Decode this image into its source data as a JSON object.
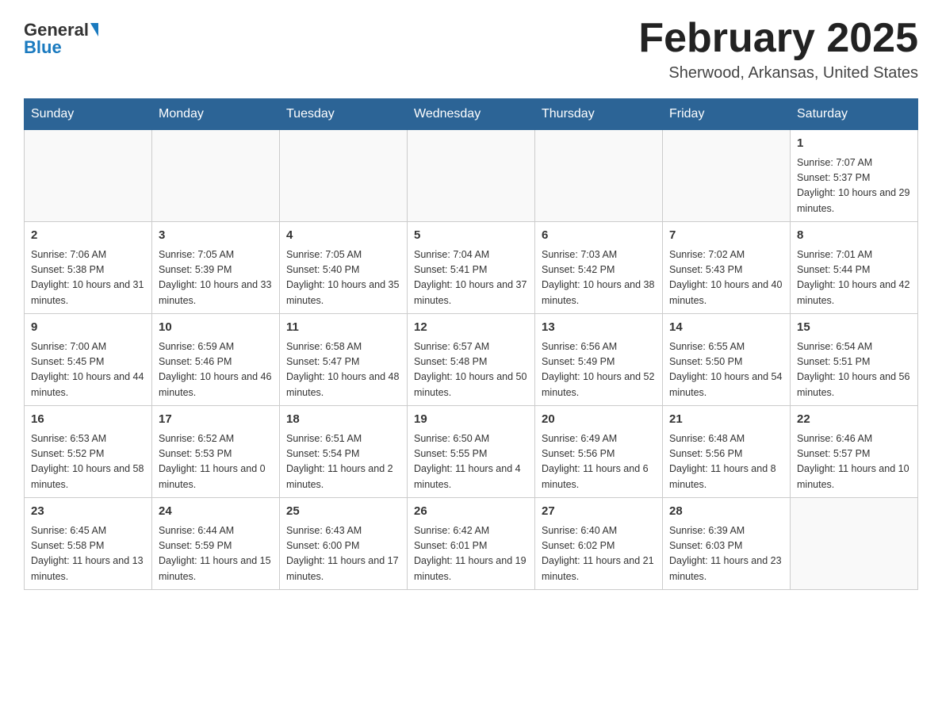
{
  "header": {
    "logo_general": "General",
    "logo_blue": "Blue",
    "title": "February 2025",
    "subtitle": "Sherwood, Arkansas, United States"
  },
  "days_of_week": [
    "Sunday",
    "Monday",
    "Tuesday",
    "Wednesday",
    "Thursday",
    "Friday",
    "Saturday"
  ],
  "weeks": [
    [
      {
        "day": "",
        "info": ""
      },
      {
        "day": "",
        "info": ""
      },
      {
        "day": "",
        "info": ""
      },
      {
        "day": "",
        "info": ""
      },
      {
        "day": "",
        "info": ""
      },
      {
        "day": "",
        "info": ""
      },
      {
        "day": "1",
        "info": "Sunrise: 7:07 AM\nSunset: 5:37 PM\nDaylight: 10 hours and 29 minutes."
      }
    ],
    [
      {
        "day": "2",
        "info": "Sunrise: 7:06 AM\nSunset: 5:38 PM\nDaylight: 10 hours and 31 minutes."
      },
      {
        "day": "3",
        "info": "Sunrise: 7:05 AM\nSunset: 5:39 PM\nDaylight: 10 hours and 33 minutes."
      },
      {
        "day": "4",
        "info": "Sunrise: 7:05 AM\nSunset: 5:40 PM\nDaylight: 10 hours and 35 minutes."
      },
      {
        "day": "5",
        "info": "Sunrise: 7:04 AM\nSunset: 5:41 PM\nDaylight: 10 hours and 37 minutes."
      },
      {
        "day": "6",
        "info": "Sunrise: 7:03 AM\nSunset: 5:42 PM\nDaylight: 10 hours and 38 minutes."
      },
      {
        "day": "7",
        "info": "Sunrise: 7:02 AM\nSunset: 5:43 PM\nDaylight: 10 hours and 40 minutes."
      },
      {
        "day": "8",
        "info": "Sunrise: 7:01 AM\nSunset: 5:44 PM\nDaylight: 10 hours and 42 minutes."
      }
    ],
    [
      {
        "day": "9",
        "info": "Sunrise: 7:00 AM\nSunset: 5:45 PM\nDaylight: 10 hours and 44 minutes."
      },
      {
        "day": "10",
        "info": "Sunrise: 6:59 AM\nSunset: 5:46 PM\nDaylight: 10 hours and 46 minutes."
      },
      {
        "day": "11",
        "info": "Sunrise: 6:58 AM\nSunset: 5:47 PM\nDaylight: 10 hours and 48 minutes."
      },
      {
        "day": "12",
        "info": "Sunrise: 6:57 AM\nSunset: 5:48 PM\nDaylight: 10 hours and 50 minutes."
      },
      {
        "day": "13",
        "info": "Sunrise: 6:56 AM\nSunset: 5:49 PM\nDaylight: 10 hours and 52 minutes."
      },
      {
        "day": "14",
        "info": "Sunrise: 6:55 AM\nSunset: 5:50 PM\nDaylight: 10 hours and 54 minutes."
      },
      {
        "day": "15",
        "info": "Sunrise: 6:54 AM\nSunset: 5:51 PM\nDaylight: 10 hours and 56 minutes."
      }
    ],
    [
      {
        "day": "16",
        "info": "Sunrise: 6:53 AM\nSunset: 5:52 PM\nDaylight: 10 hours and 58 minutes."
      },
      {
        "day": "17",
        "info": "Sunrise: 6:52 AM\nSunset: 5:53 PM\nDaylight: 11 hours and 0 minutes."
      },
      {
        "day": "18",
        "info": "Sunrise: 6:51 AM\nSunset: 5:54 PM\nDaylight: 11 hours and 2 minutes."
      },
      {
        "day": "19",
        "info": "Sunrise: 6:50 AM\nSunset: 5:55 PM\nDaylight: 11 hours and 4 minutes."
      },
      {
        "day": "20",
        "info": "Sunrise: 6:49 AM\nSunset: 5:56 PM\nDaylight: 11 hours and 6 minutes."
      },
      {
        "day": "21",
        "info": "Sunrise: 6:48 AM\nSunset: 5:56 PM\nDaylight: 11 hours and 8 minutes."
      },
      {
        "day": "22",
        "info": "Sunrise: 6:46 AM\nSunset: 5:57 PM\nDaylight: 11 hours and 10 minutes."
      }
    ],
    [
      {
        "day": "23",
        "info": "Sunrise: 6:45 AM\nSunset: 5:58 PM\nDaylight: 11 hours and 13 minutes."
      },
      {
        "day": "24",
        "info": "Sunrise: 6:44 AM\nSunset: 5:59 PM\nDaylight: 11 hours and 15 minutes."
      },
      {
        "day": "25",
        "info": "Sunrise: 6:43 AM\nSunset: 6:00 PM\nDaylight: 11 hours and 17 minutes."
      },
      {
        "day": "26",
        "info": "Sunrise: 6:42 AM\nSunset: 6:01 PM\nDaylight: 11 hours and 19 minutes."
      },
      {
        "day": "27",
        "info": "Sunrise: 6:40 AM\nSunset: 6:02 PM\nDaylight: 11 hours and 21 minutes."
      },
      {
        "day": "28",
        "info": "Sunrise: 6:39 AM\nSunset: 6:03 PM\nDaylight: 11 hours and 23 minutes."
      },
      {
        "day": "",
        "info": ""
      }
    ]
  ]
}
